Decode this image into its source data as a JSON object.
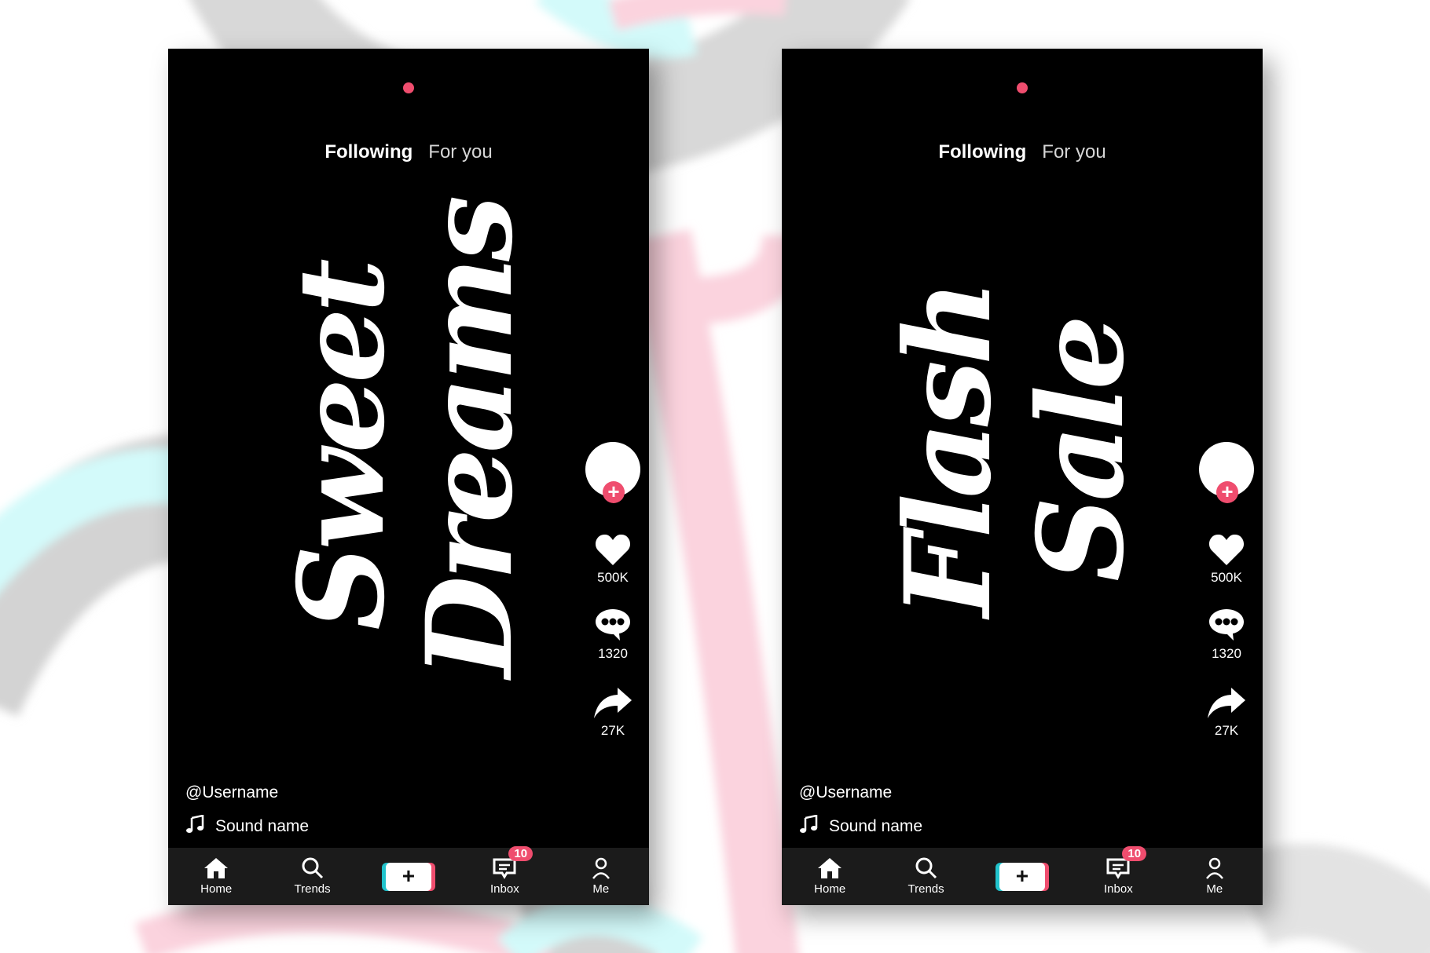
{
  "colors": {
    "accent": "#ef4d6e",
    "cyan": "#21c3cc",
    "screen": "#000000",
    "navbar": "#1b1b1b"
  },
  "phones": [
    {
      "tabs": {
        "following": "Following",
        "for_you": "For you"
      },
      "artwork_lines": [
        "Sweet",
        "Dreams"
      ],
      "likes": "500K",
      "comments": "1320",
      "shares": "27K",
      "username": "@Username",
      "sound": "Sound name",
      "nav": {
        "home": "Home",
        "trends": "Trends",
        "create": "+",
        "inbox": "Inbox",
        "inbox_badge": "10",
        "me": "Me"
      }
    },
    {
      "tabs": {
        "following": "Following",
        "for_you": "For you"
      },
      "artwork_lines": [
        "Flash",
        "Sale"
      ],
      "likes": "500K",
      "comments": "1320",
      "shares": "27K",
      "username": "@Username",
      "sound": "Sound name",
      "nav": {
        "home": "Home",
        "trends": "Trends",
        "create": "+",
        "inbox": "Inbox",
        "inbox_badge": "10",
        "me": "Me"
      }
    }
  ]
}
